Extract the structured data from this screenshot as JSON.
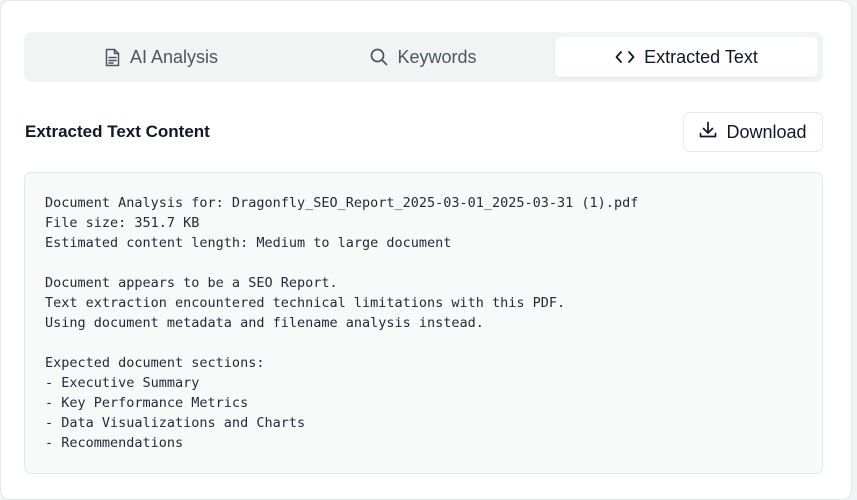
{
  "tabs": [
    {
      "label": "AI Analysis",
      "icon": "document-icon",
      "active": false
    },
    {
      "label": "Keywords",
      "icon": "search-icon",
      "active": false
    },
    {
      "label": "Extracted Text",
      "icon": "code-icon",
      "active": true
    }
  ],
  "section": {
    "title": "Extracted Text Content",
    "download_label": "Download"
  },
  "extracted_text": "Document Analysis for: Dragonfly_SEO_Report_2025-03-01_2025-03-31 (1).pdf\nFile size: 351.7 KB\nEstimated content length: Medium to large document\n\nDocument appears to be a SEO Report.\nText extraction encountered technical limitations with this PDF.\nUsing document metadata and filename analysis instead.\n\nExpected document sections:\n- Executive Summary\n- Key Performance Metrics\n- Data Visualizations and Charts\n- Recommendations",
  "colors": {
    "tab_bar_bg": "#f1f4f2",
    "active_tab_bg": "#ffffff",
    "text_box_bg": "#f8f9f9",
    "border": "#e5e7eb"
  }
}
